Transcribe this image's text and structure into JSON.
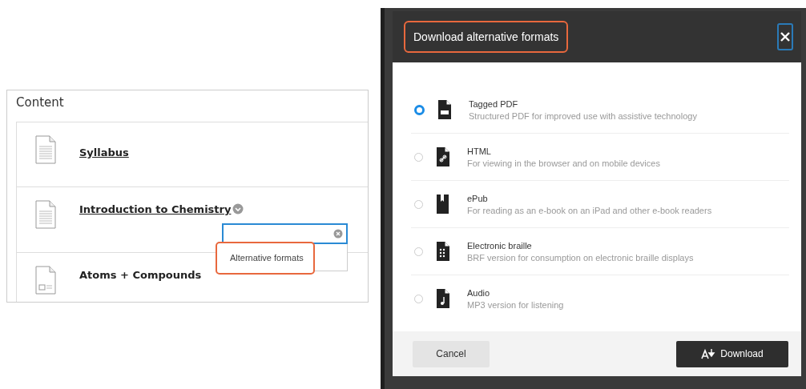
{
  "content_panel": {
    "title": "Content",
    "items": [
      {
        "kind": "document",
        "title": "Syllabus",
        "link": true
      },
      {
        "kind": "document",
        "title": "Introduction to Chemistry",
        "link": true,
        "menu_open": true
      },
      {
        "kind": "attachment",
        "title": "Atoms + Compounds",
        "link": false
      }
    ]
  },
  "context_menu": {
    "items": [
      "Alternative formats"
    ]
  },
  "dialog": {
    "title": "Download alternative formats",
    "options": [
      {
        "kind": "pdf",
        "label": "Tagged PDF",
        "description": "Structured PDF for improved use with assistive technology",
        "selected": true
      },
      {
        "kind": "html",
        "label": "HTML",
        "description": "For viewing in the browser and on mobile devices",
        "selected": false
      },
      {
        "kind": "epub",
        "label": "ePub",
        "description": "For reading as an e-book on an iPad and other e-book readers",
        "selected": false
      },
      {
        "kind": "braille",
        "label": "Electronic braille",
        "description": "BRF version for consumption on electronic braille displays",
        "selected": false
      },
      {
        "kind": "audio",
        "label": "Audio",
        "description": "MP3 version for listening",
        "selected": false
      }
    ],
    "buttons": [
      {
        "kind": "secondary",
        "label": "Cancel"
      },
      {
        "kind": "primary",
        "label": "Download"
      }
    ]
  }
}
